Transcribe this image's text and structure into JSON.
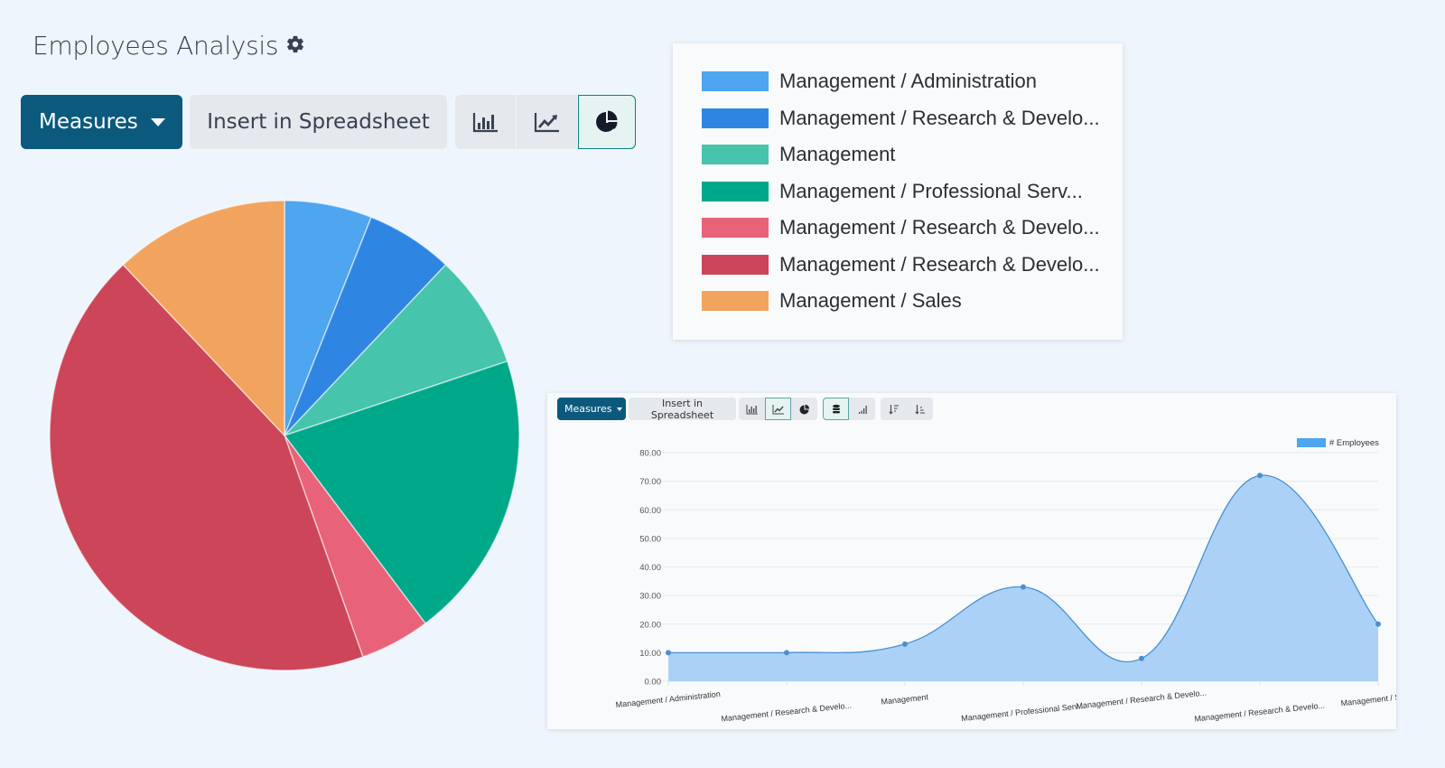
{
  "page": {
    "title": "Employees Analysis",
    "settings_icon": "gear-icon"
  },
  "toolbar": {
    "measures_label": "Measures",
    "insert_label": "Insert in Spreadsheet",
    "chart_buttons": [
      {
        "icon": "bar-chart-icon",
        "active": false
      },
      {
        "icon": "line-chart-icon",
        "active": false
      },
      {
        "icon": "pie-chart-icon",
        "active": true
      }
    ]
  },
  "mini_toolbar": {
    "measures_label": "Measures",
    "insert_label": "Insert in Spreadsheet",
    "buttons": [
      {
        "icon": "bar-chart-icon",
        "active": false
      },
      {
        "icon": "line-chart-icon",
        "active": true
      },
      {
        "icon": "pie-chart-icon",
        "active": false
      },
      {
        "icon": "stacked-database-icon",
        "active": true
      },
      {
        "icon": "cumulative-icon",
        "active": false
      },
      {
        "icon": "sort-descending-icon",
        "active": false
      },
      {
        "icon": "sort-ascending-icon",
        "active": false
      }
    ]
  },
  "colors": {
    "accent": "#0b5a7e",
    "line": "#4a90d0",
    "area": "#a6d0f5"
  },
  "chart_data": [
    {
      "type": "pie",
      "title": "",
      "categories": [
        "Management / Administration",
        "Management / Research & Develo...",
        "Management",
        "Management / Professional Serv...",
        "Management / Research & Develo...",
        "Management / Research & Develo...",
        "Management / Sales"
      ],
      "values": [
        10,
        10,
        13,
        33,
        8,
        72,
        20
      ],
      "colors": [
        "#4ea5f0",
        "#2f86e2",
        "#46c4ac",
        "#00a88a",
        "#e8637a",
        "#cc4558",
        "#f2a45f"
      ],
      "legend_position": "right"
    },
    {
      "type": "area",
      "title": "",
      "categories": [
        "Management / Administration",
        "Management / Research & Develo...",
        "Management",
        "Management / Professional Serv...",
        "Management / Research & Develo...",
        "Management / Research & Develo...",
        "Management / Sales"
      ],
      "series": [
        {
          "name": "# Employees",
          "values": [
            10,
            10,
            13,
            33,
            8,
            72,
            20
          ]
        }
      ],
      "yticks": [
        "0.00",
        "10.00",
        "20.00",
        "30.00",
        "40.00",
        "50.00",
        "60.00",
        "70.00",
        "80.00"
      ],
      "ylim": [
        0,
        80
      ],
      "xlabel": "",
      "ylabel": "",
      "grid": true,
      "legend_position": "top-right"
    }
  ]
}
